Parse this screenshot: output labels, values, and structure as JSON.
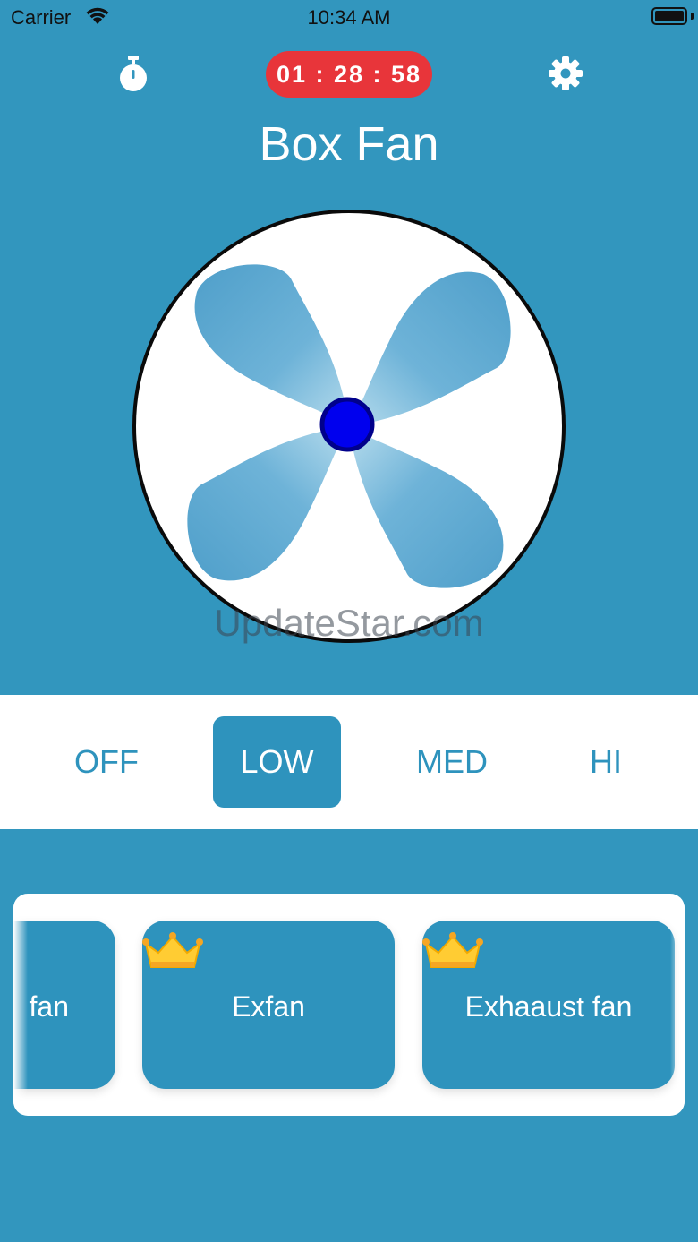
{
  "status_bar": {
    "carrier": "Carrier",
    "time": "10:34 AM"
  },
  "header": {
    "timer_icon": "stopwatch-icon",
    "timer_value": "01 : 28 : 58",
    "settings_icon": "gear-icon",
    "title": "Box Fan"
  },
  "fan": {
    "blade_color": "#5aa8cf",
    "hub_color": "#0000ee"
  },
  "watermark": "UpdateStar.com",
  "speeds": {
    "selected": "LOW",
    "options": [
      "OFF",
      "LOW",
      "MED",
      "HI"
    ]
  },
  "fan_types": [
    {
      "label": "fan",
      "premium": false
    },
    {
      "label": "Exfan",
      "premium": true,
      "badge_icon": "crown-icon"
    },
    {
      "label": "Exhaaust fan",
      "premium": true,
      "badge_icon": "crown-icon"
    }
  ],
  "colors": {
    "background": "#3296be",
    "accent": "#2e93bd",
    "timer_bg": "#e8353a"
  }
}
